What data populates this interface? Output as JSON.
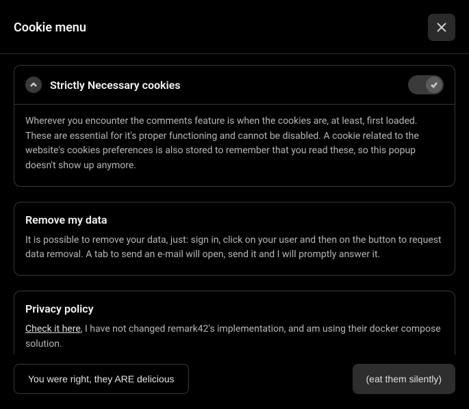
{
  "header": {
    "title": "Cookie menu"
  },
  "sections": {
    "necessary": {
      "title": "Strictly Necessary cookies",
      "body": "Wherever you encounter the comments feature is when the cookies are, at least, first loaded. These are essential for it's proper functioning and cannot be disabled. A cookie related to the website's cookies preferences is also stored to remember that you read these, so this popup doesn't show up anymore."
    },
    "remove": {
      "title": "Remove my data",
      "body": "It is possible to remove your data, just: sign in, click on your user and then on the button to request data removal. A tab to send an e-mail will open, send it and I will promptly answer it."
    },
    "privacy": {
      "title": "Privacy policy",
      "link_text": "Check it here",
      "body_suffix": ", I have not changed remark42's implementation, and am using their docker compose solution."
    }
  },
  "footer": {
    "left_button": "You were right, they ARE delicious",
    "right_button": "(eat them silently)"
  }
}
